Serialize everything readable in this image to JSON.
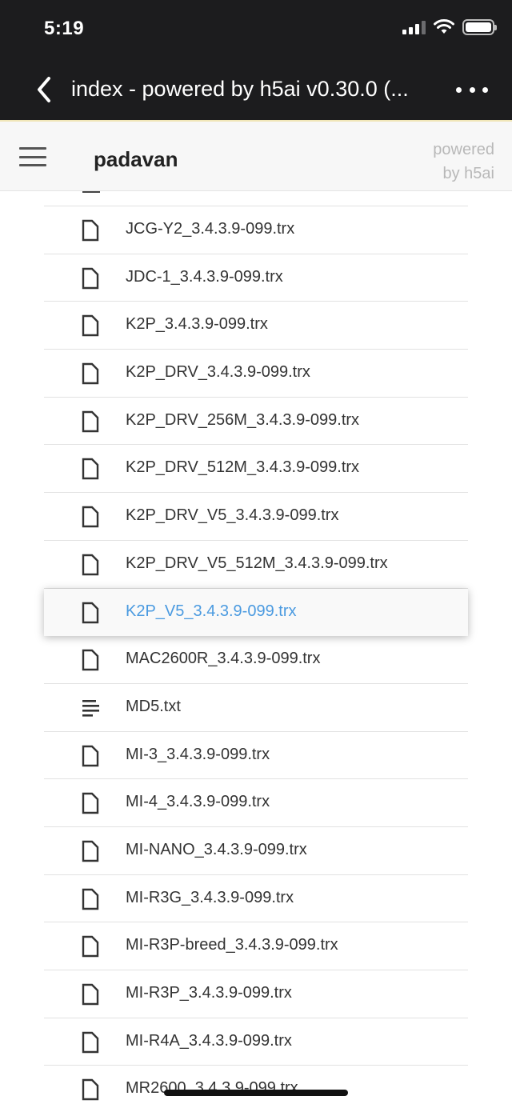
{
  "status_bar": {
    "time": "5:19"
  },
  "nav": {
    "title": "index - powered by h5ai v0.30.0 (..."
  },
  "header": {
    "breadcrumb": "padavan",
    "powered_line1": "powered",
    "powered_line2": "by h5ai"
  },
  "colors": {
    "active_link": "#4a9ae0",
    "nav_bg": "#1c1c1e"
  },
  "files": [
    {
      "name": "JCG-Y2_3.4.3.9-099.trx",
      "icon": "file-icon"
    },
    {
      "name": "JDC-1_3.4.3.9-099.trx",
      "icon": "file-icon"
    },
    {
      "name": "K2P_3.4.3.9-099.trx",
      "icon": "file-icon"
    },
    {
      "name": "K2P_DRV_3.4.3.9-099.trx",
      "icon": "file-icon"
    },
    {
      "name": "K2P_DRV_256M_3.4.3.9-099.trx",
      "icon": "file-icon"
    },
    {
      "name": "K2P_DRV_512M_3.4.3.9-099.trx",
      "icon": "file-icon"
    },
    {
      "name": "K2P_DRV_V5_3.4.3.9-099.trx",
      "icon": "file-icon"
    },
    {
      "name": "K2P_DRV_V5_512M_3.4.3.9-099.trx",
      "icon": "file-icon"
    },
    {
      "name": "K2P_V5_3.4.3.9-099.trx",
      "icon": "file-icon",
      "active": true
    },
    {
      "name": "MAC2600R_3.4.3.9-099.trx",
      "icon": "file-icon"
    },
    {
      "name": "MD5.txt",
      "icon": "text-file-icon"
    },
    {
      "name": "MI-3_3.4.3.9-099.trx",
      "icon": "file-icon"
    },
    {
      "name": "MI-4_3.4.3.9-099.trx",
      "icon": "file-icon"
    },
    {
      "name": "MI-NANO_3.4.3.9-099.trx",
      "icon": "file-icon"
    },
    {
      "name": "MI-R3G_3.4.3.9-099.trx",
      "icon": "file-icon"
    },
    {
      "name": "MI-R3P-breed_3.4.3.9-099.trx",
      "icon": "file-icon"
    },
    {
      "name": "MI-R3P_3.4.3.9-099.trx",
      "icon": "file-icon"
    },
    {
      "name": "MI-R4A_3.4.3.9-099.trx",
      "icon": "file-icon"
    },
    {
      "name": "MR2600_3.4.3.9-099.trx",
      "icon": "file-icon"
    }
  ]
}
